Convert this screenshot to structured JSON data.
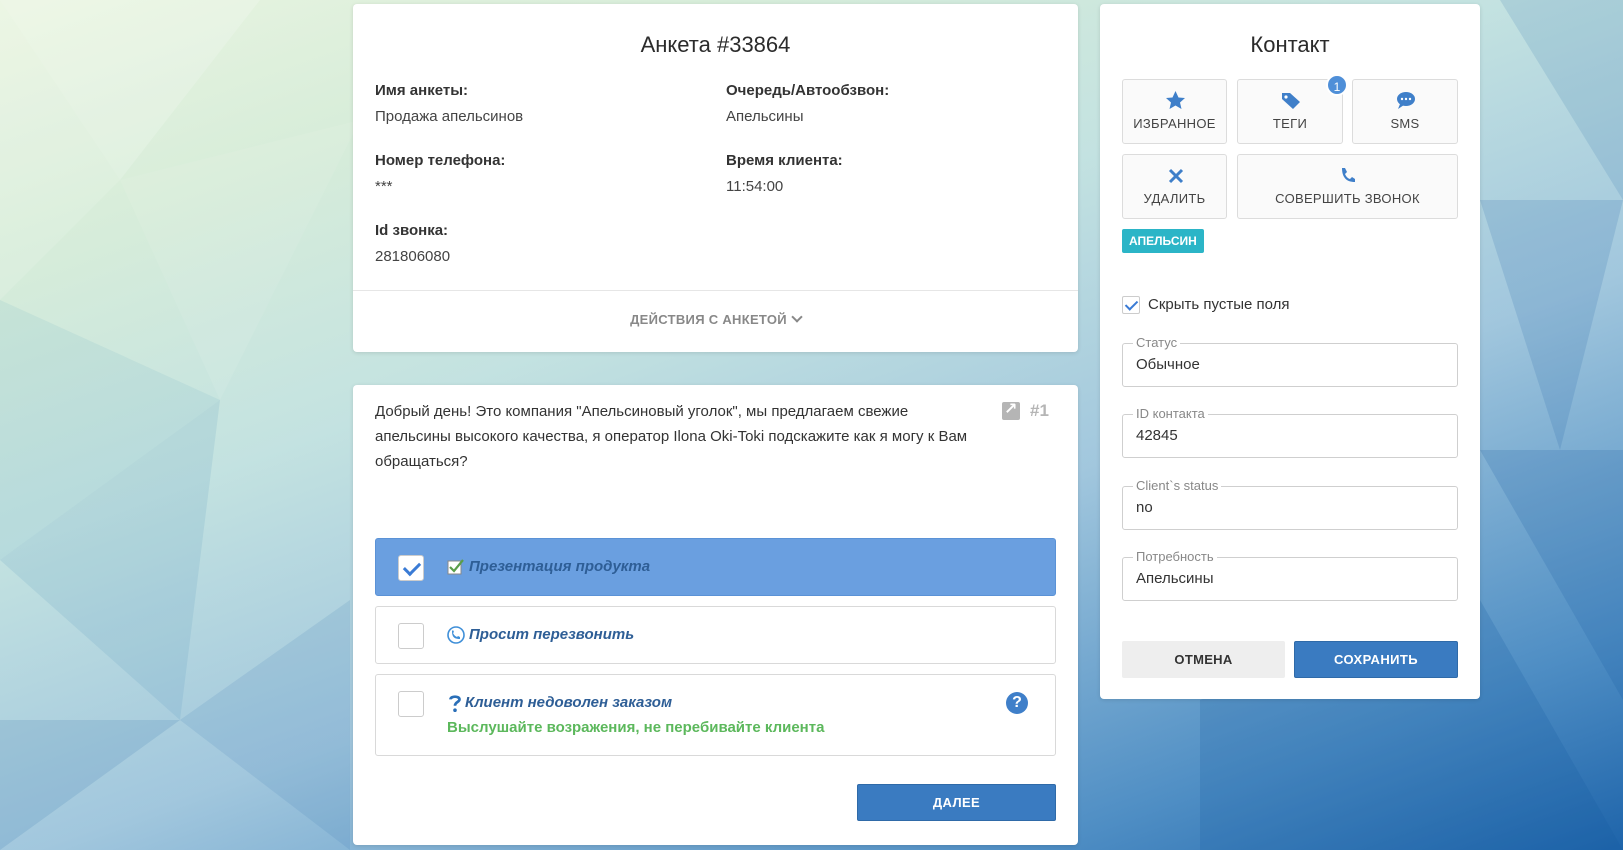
{
  "anketa": {
    "title": "Анкета #33864",
    "fields": [
      {
        "label": "Имя анкеты:",
        "value": "Продажа апельсинов"
      },
      {
        "label": "Очередь/Автообзвон:",
        "value": "Апельсины"
      },
      {
        "label": "Номер телефона:",
        "value": "***"
      },
      {
        "label": "Время клиента:",
        "value": "11:54:00"
      },
      {
        "label": "Id звонка:",
        "value": "281806080"
      }
    ],
    "actions_label": "ДЕЙСТВИЯ С АНКЕТОЙ"
  },
  "script": {
    "text": "Добрый день! Это компания \"Апельсиновый уголок\", мы предлагаем свежие апельсины высокого качества, я оператор Ilona Oki-Toki подскажите как я могу к Вам обращаться?",
    "number": "#1",
    "options": [
      {
        "label": "Презентация продукта",
        "icon": "checklist-icon",
        "checked": true,
        "hint": ""
      },
      {
        "label": "Просит перезвонить",
        "icon": "phone-callback-icon",
        "checked": false,
        "hint": ""
      },
      {
        "label": "Клиент недоволен заказом",
        "icon": "question-icon",
        "checked": false,
        "hint": "Выслушайте возражения, не перебивайте клиента"
      }
    ],
    "next_label": "ДАЛЕЕ"
  },
  "contact": {
    "title": "Контакт",
    "tiles": [
      {
        "label": "ИЗБРАННОЕ",
        "icon": "star-icon"
      },
      {
        "label": "ТЕГИ",
        "icon": "tags-icon"
      },
      {
        "label": "SMS",
        "icon": "chat-bubble-icon"
      },
      {
        "label": "УДАЛИТЬ",
        "icon": "close-icon"
      },
      {
        "label": "СОВЕРШИТЬ ЗВОНОК",
        "icon": "phone-icon"
      }
    ],
    "tags_badge": "1",
    "tag_chip": "АПЕЛЬСИН",
    "hide_empty_label": "Скрыть пустые поля",
    "hide_empty_checked": true,
    "fields": [
      {
        "label": "Статус",
        "value": "Обычное"
      },
      {
        "label": "ID контакта",
        "value": "42845"
      },
      {
        "label": "Client`s status",
        "value": "no"
      },
      {
        "label": "Потребность",
        "value": "Апельсины"
      }
    ],
    "cancel_label": "ОТМЕНА",
    "save_label": "СОХРАНИТЬ"
  },
  "colors": {
    "primary": "#3a7bc1",
    "checked_option": "#6a9fe0",
    "tag_chip": "#2bb5c7",
    "hint_green": "#5cb85c"
  }
}
